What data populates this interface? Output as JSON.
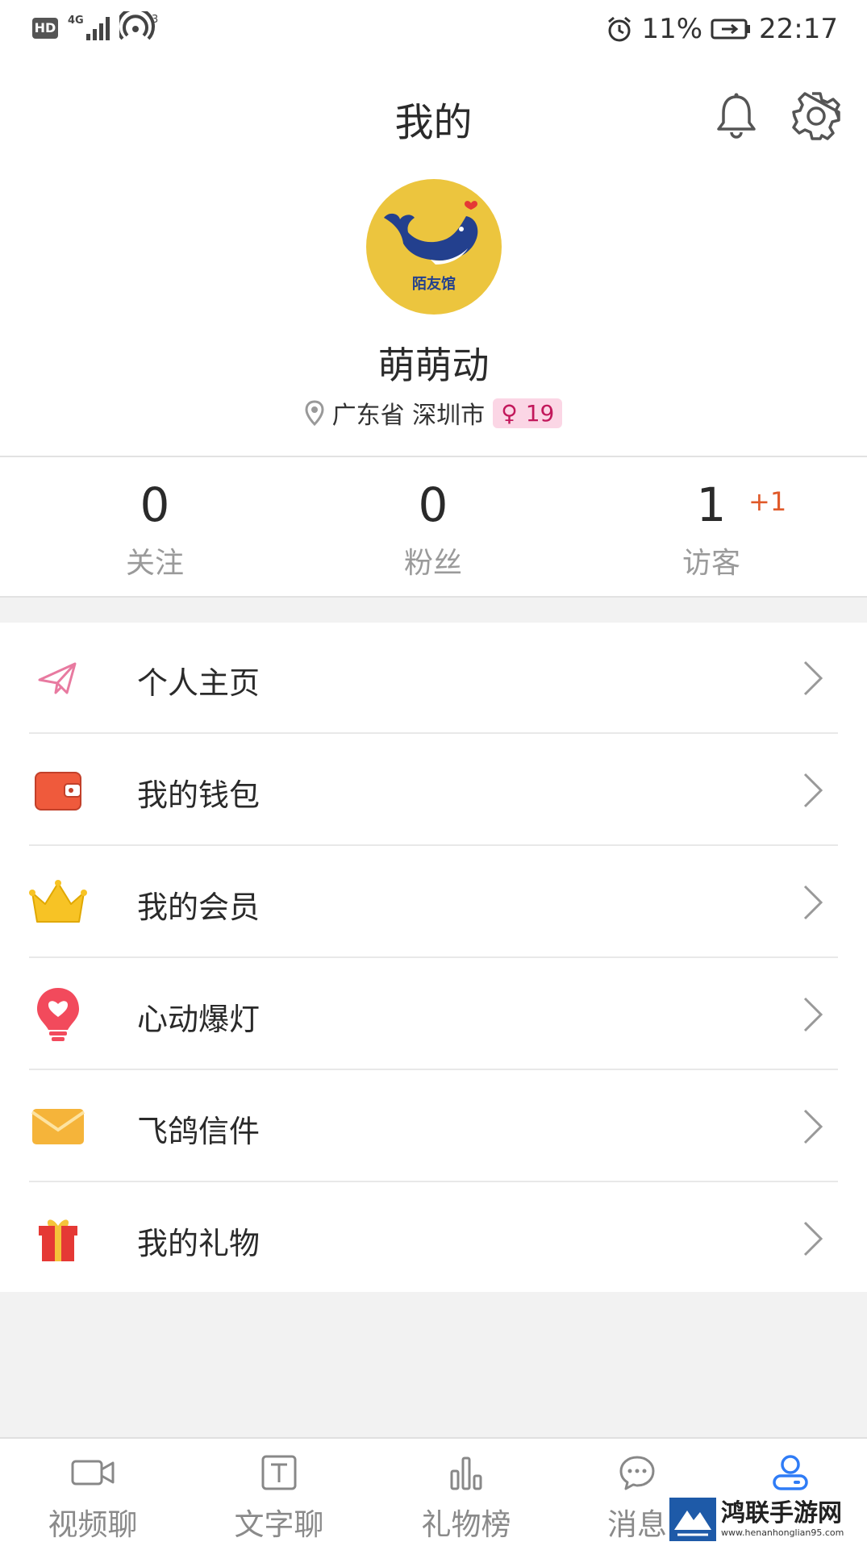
{
  "status_bar": {
    "hd": "HD",
    "network": "4G",
    "wifi_badge": "3",
    "battery_percent": "11%",
    "time": "22:17"
  },
  "header": {
    "title": "我的",
    "bell_icon": "bell-icon",
    "settings_icon": "gear-icon"
  },
  "profile": {
    "avatar_text": "陌友馆",
    "nickname": "萌萌动",
    "location": "广东省 深圳市",
    "gender_symbol": "♀",
    "age": "19"
  },
  "stats": [
    {
      "value": "0",
      "label": "关注"
    },
    {
      "value": "0",
      "label": "粉丝"
    },
    {
      "value": "1",
      "label": "访客",
      "delta": "+1"
    }
  ],
  "menu": [
    {
      "label": "个人主页",
      "icon": "paper-plane-icon"
    },
    {
      "label": "我的钱包",
      "icon": "wallet-icon"
    },
    {
      "label": "我的会员",
      "icon": "crown-icon"
    },
    {
      "label": "心动爆灯",
      "icon": "heart-bulb-icon"
    },
    {
      "label": "飞鸽信件",
      "icon": "envelope-icon"
    },
    {
      "label": "我的礼物",
      "icon": "gift-icon"
    }
  ],
  "bottom_nav": [
    {
      "label": "视频聊",
      "icon": "video-camera-icon"
    },
    {
      "label": "文字聊",
      "icon": "text-icon"
    },
    {
      "label": "礼物榜",
      "icon": "bar-chart-icon"
    },
    {
      "label": "消息",
      "icon": "chat-bubble-icon"
    },
    {
      "label": "",
      "icon": "user-icon",
      "active": true
    }
  ],
  "watermark": {
    "main": "鸿联手游网",
    "sub": "www.henanhonglian95.com"
  },
  "colors": {
    "accent": "#2f7cf6",
    "badge_pink": "#fbd6e5",
    "delta_orange": "#e05a2a"
  }
}
